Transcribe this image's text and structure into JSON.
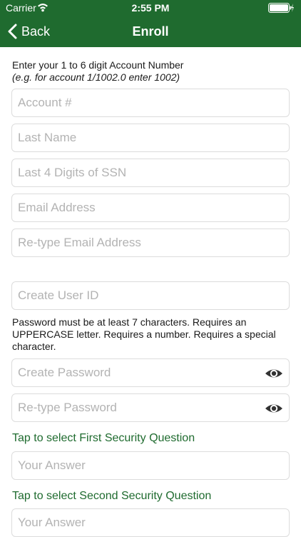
{
  "status_bar": {
    "carrier": "Carrier",
    "time": "2:55 PM",
    "wifi_icon": "wifi-icon",
    "battery_icon": "battery-charging-icon"
  },
  "nav": {
    "back_label": "Back",
    "title": "Enroll",
    "back_icon": "chevron-left-icon",
    "bar_color": "#1f6b2f"
  },
  "form": {
    "account_instruction_line1": "Enter your 1 to 6 digit Account Number",
    "account_instruction_line2": "(e.g. for account 1/1002.0 enter 1002)",
    "account_placeholder": "Account #",
    "last_name_placeholder": "Last Name",
    "ssn_placeholder": "Last 4 Digits of SSN",
    "email_placeholder": "Email Address",
    "email_confirm_placeholder": "Re-type Email Address",
    "user_id_placeholder": "Create User ID",
    "password_rules": "Password must be at least 7 characters. Requires an UPPERCASE letter. Requires a number. Requires a special character.",
    "password_placeholder": "Create Password",
    "password_confirm_placeholder": "Re-type Password",
    "eye_icon": "eye-icon",
    "security_question_1": "Tap to select First Security Question",
    "answer_1_placeholder": "Your Answer",
    "security_question_2": "Tap to select Second Security Question",
    "answer_2_placeholder": "Your Answer",
    "link_color": "#1f6b2f"
  }
}
